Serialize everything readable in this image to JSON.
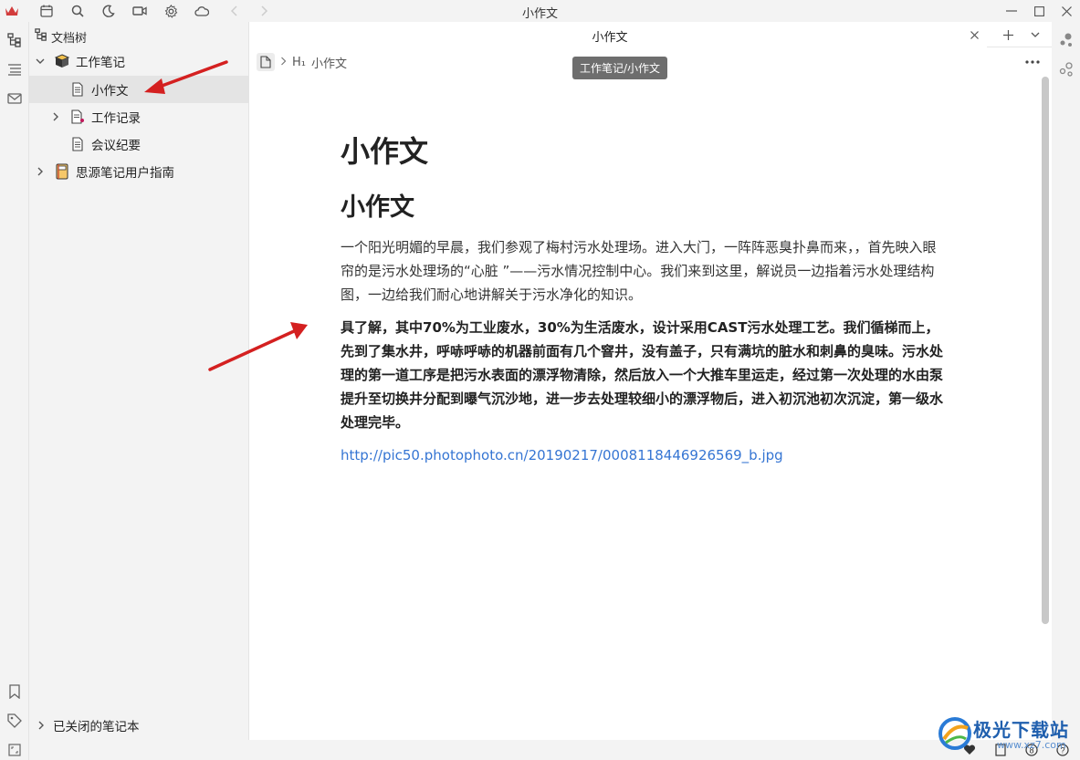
{
  "titlebar": {
    "title": "小作文",
    "colors": {
      "logo": "#d23c3c"
    }
  },
  "tree": {
    "header_label": "文档树",
    "notebook": {
      "label": "工作笔记"
    },
    "items": [
      {
        "label": "小作文"
      },
      {
        "label": "工作记录"
      },
      {
        "label": "会议纪要"
      }
    ],
    "guide": {
      "label": "思源笔记用户指南"
    },
    "closed_notebooks_label": "已关闭的笔记本"
  },
  "tab": {
    "label": "小作文"
  },
  "breadcrumb": {
    "heading_marker": "H₁",
    "label": "小作文"
  },
  "tooltip": "工作笔记/小作文",
  "doc": {
    "title": "小作文",
    "h1": "小作文",
    "p1": "一个阳光明媚的早晨，我们参观了梅村污水处理场。进入大门，一阵阵恶臭扑鼻而来，，首先映入眼帘的是污水处理场的“心脏 ”——污水情况控制中心。我们来到这里，解说员一边指着污水处理结构图，一边给我们耐心地讲解关于污水净化的知识。",
    "p2": "具了解，其中70%为工业废水，30%为生活废水，设计采用CAST污水处理工艺。我们循梯而上，先到了集水井，呼哧呼哧的机器前面有几个窨井，没有盖子，只有满坑的脏水和刺鼻的臭味。污水处理的第一道工序是把污水表面的漂浮物清除，然后放入一个大推车里运走，经过第一次处理的水由泵提升至切换井分配到曝气沉沙地，进一步去处理较细小的漂浮物后，进入初沉池初次沉淀，第一级水处理完毕。",
    "link": "http://pic50.photophoto.cn/20190217/0008118446926569_b.jpg",
    "colors": {
      "link": "#3575d3",
      "annotation_arrow": "#d42020"
    }
  },
  "watermark": {
    "text": "极光下载站",
    "url": "www.xz7.com"
  }
}
